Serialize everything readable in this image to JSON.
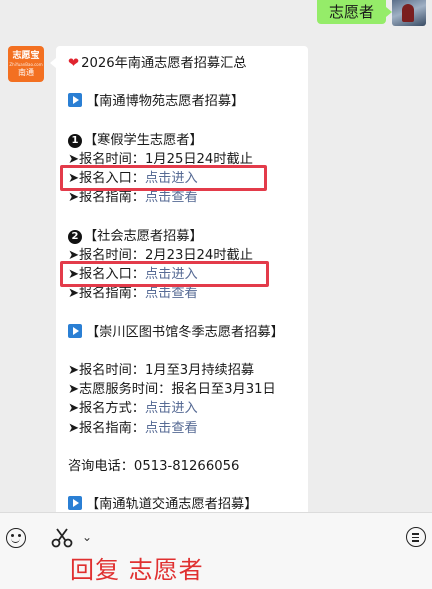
{
  "outgoing": {
    "text": "志愿者"
  },
  "bot_avatar": {
    "line1": "志愿宝",
    "line2": "ZhiYuanBao.com",
    "line3": "南通"
  },
  "message": {
    "title": "2026年南通志愿者招募汇总",
    "section1": {
      "header": "【南通博物苑志愿者招募】",
      "sub1": {
        "num": "1",
        "title": "【寒假学生志愿者】",
        "time_label": "➤报名时间：",
        "time_value": "1月25日24时截止",
        "entry_label": "➤报名入口：",
        "entry_link": "点击进入",
        "guide_label": "➤报名指南：",
        "guide_link": "点击查看"
      },
      "sub2": {
        "num": "2",
        "title": "【社会志愿者招募】",
        "time_label": "➤报名时间：",
        "time_value": "2月23日24时截止",
        "entry_label": "➤报名入口：",
        "entry_link": "点击进入",
        "guide_label": "➤报名指南：",
        "guide_link": "点击查看"
      }
    },
    "section2": {
      "header": "【崇川区图书馆冬季志愿者招募】",
      "time_label": "➤报名时间：",
      "time_value": "1月至3月持续招募",
      "service_label": "➤志愿服务时间：",
      "service_value": "报名日至3月31日",
      "method_label": "➤报名方式：",
      "method_link": "点击进入",
      "guide_label": "➤报名指南：",
      "guide_link": "点击查看"
    },
    "consult": "咨询电话：0513-81266056",
    "section3": {
      "header": "【南通轨道交通志愿者招募】"
    }
  },
  "bottom": {
    "reply_overlay": "回复 志愿者"
  },
  "colors": {
    "link": "#576b95",
    "highlight": "#e33b4a",
    "overlay": "#e03030",
    "outgoing_bubble": "#95ec69"
  }
}
